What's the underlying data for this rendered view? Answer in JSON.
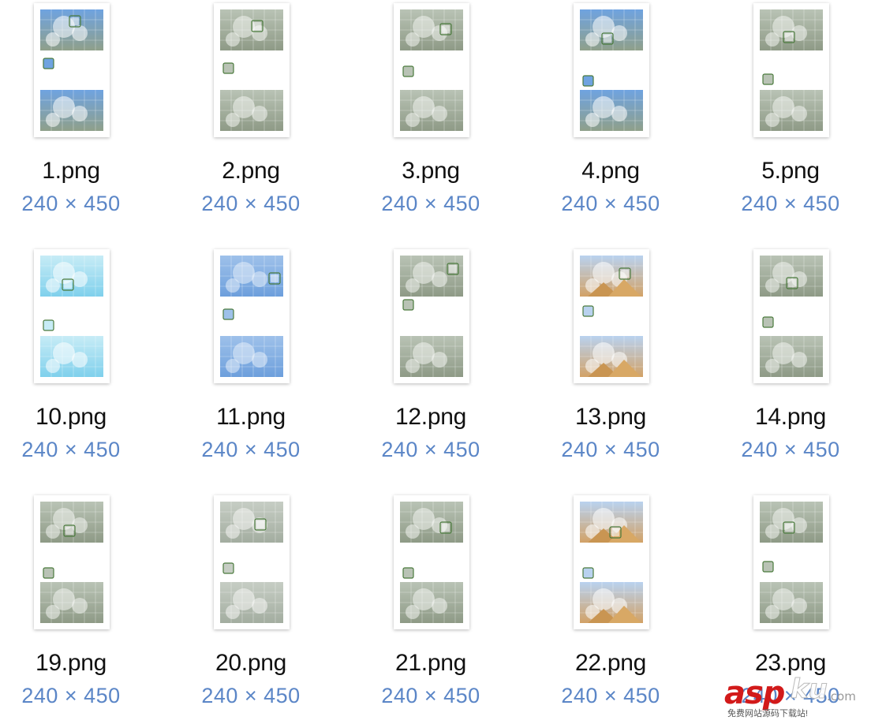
{
  "files": [
    {
      "name": "1.png",
      "dims": "240 × 450",
      "theme": "sky"
    },
    {
      "name": "2.png",
      "dims": "240 × 450",
      "theme": "waterfall"
    },
    {
      "name": "3.png",
      "dims": "240 × 450",
      "theme": "waterfall"
    },
    {
      "name": "4.png",
      "dims": "240 × 450",
      "theme": "sky"
    },
    {
      "name": "5.png",
      "dims": "240 × 450",
      "theme": "waterfall"
    },
    {
      "name": "10.png",
      "dims": "240 × 450",
      "theme": "ice"
    },
    {
      "name": "11.png",
      "dims": "240 × 450",
      "theme": "blue"
    },
    {
      "name": "12.png",
      "dims": "240 × 450",
      "theme": "waterfall"
    },
    {
      "name": "13.png",
      "dims": "240 × 450",
      "theme": "pyramid"
    },
    {
      "name": "14.png",
      "dims": "240 × 450",
      "theme": "waterfall"
    },
    {
      "name": "19.png",
      "dims": "240 × 450",
      "theme": "waterfall"
    },
    {
      "name": "20.png",
      "dims": "240 × 450",
      "theme": "mist"
    },
    {
      "name": "21.png",
      "dims": "240 × 450",
      "theme": "waterfall"
    },
    {
      "name": "22.png",
      "dims": "240 × 450",
      "theme": "pyramid"
    },
    {
      "name": "23.png",
      "dims": "240 × 450",
      "theme": "waterfall"
    }
  ],
  "watermark": {
    "brand_asp": "asp",
    "brand_ku": "ku",
    "brand_com": ".com",
    "tagline": "免费网站源码下载站!"
  },
  "colors": {
    "filename": "#111111",
    "dimensions": "#5b86c7",
    "watermark_red": "#d21a1a"
  }
}
